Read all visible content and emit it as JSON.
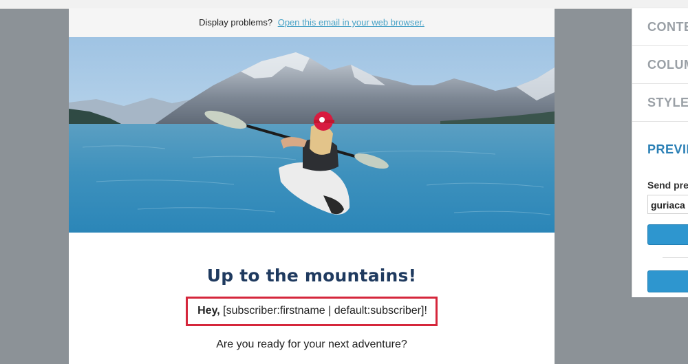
{
  "email": {
    "display_problems_text": "Display problems?",
    "open_in_browser_link": "Open this email in your web browser.",
    "hero_image": {
      "alt": "woman kayaking on a mountain lake",
      "subject": "kayak-mountain-lake"
    },
    "headline": "Up to the mountains!",
    "greeting_bold": "Hey,",
    "greeting_shortcode": "[subscriber:firstname | default:subscriber]!",
    "question": "Are you ready for your next adventure?",
    "colors": {
      "headline": "#1f3a5f",
      "highlight_border": "#d5263b",
      "link": "#4aa3c7"
    }
  },
  "sidebar": {
    "tabs": [
      {
        "label": "CONTE"
      },
      {
        "label": "COLUM"
      },
      {
        "label": "STYLES"
      },
      {
        "label": "PREVIE"
      }
    ],
    "send_preview_label": "Send pre",
    "send_preview_value": "guriaca",
    "colors": {
      "active_tab": "#2a7fb5",
      "button": "#2e96cf",
      "inactive_tab": "#9aa0a6"
    }
  }
}
